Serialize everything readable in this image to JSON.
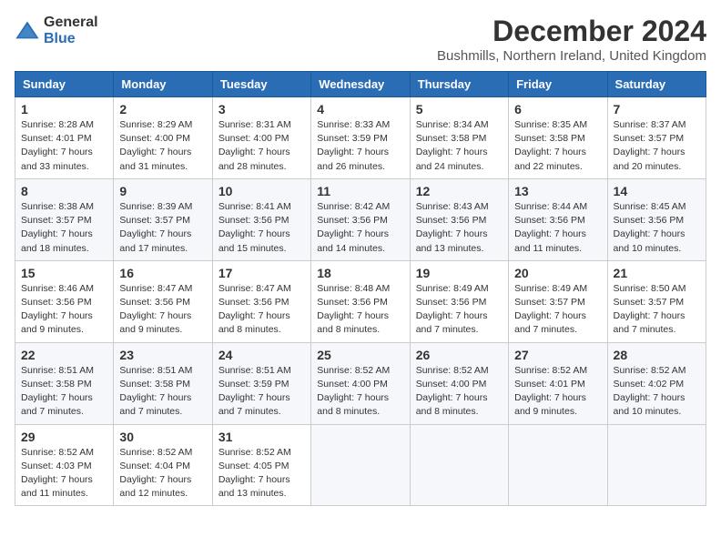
{
  "logo": {
    "general": "General",
    "blue": "Blue"
  },
  "title": "December 2024",
  "location": "Bushmills, Northern Ireland, United Kingdom",
  "days_of_week": [
    "Sunday",
    "Monday",
    "Tuesday",
    "Wednesday",
    "Thursday",
    "Friday",
    "Saturday"
  ],
  "weeks": [
    [
      {
        "day": "1",
        "sunrise": "8:28 AM",
        "sunset": "4:01 PM",
        "daylight": "7 hours and 33 minutes."
      },
      {
        "day": "2",
        "sunrise": "8:29 AM",
        "sunset": "4:00 PM",
        "daylight": "7 hours and 31 minutes."
      },
      {
        "day": "3",
        "sunrise": "8:31 AM",
        "sunset": "4:00 PM",
        "daylight": "7 hours and 28 minutes."
      },
      {
        "day": "4",
        "sunrise": "8:33 AM",
        "sunset": "3:59 PM",
        "daylight": "7 hours and 26 minutes."
      },
      {
        "day": "5",
        "sunrise": "8:34 AM",
        "sunset": "3:58 PM",
        "daylight": "7 hours and 24 minutes."
      },
      {
        "day": "6",
        "sunrise": "8:35 AM",
        "sunset": "3:58 PM",
        "daylight": "7 hours and 22 minutes."
      },
      {
        "day": "7",
        "sunrise": "8:37 AM",
        "sunset": "3:57 PM",
        "daylight": "7 hours and 20 minutes."
      }
    ],
    [
      {
        "day": "8",
        "sunrise": "8:38 AM",
        "sunset": "3:57 PM",
        "daylight": "7 hours and 18 minutes."
      },
      {
        "day": "9",
        "sunrise": "8:39 AM",
        "sunset": "3:57 PM",
        "daylight": "7 hours and 17 minutes."
      },
      {
        "day": "10",
        "sunrise": "8:41 AM",
        "sunset": "3:56 PM",
        "daylight": "7 hours and 15 minutes."
      },
      {
        "day": "11",
        "sunrise": "8:42 AM",
        "sunset": "3:56 PM",
        "daylight": "7 hours and 14 minutes."
      },
      {
        "day": "12",
        "sunrise": "8:43 AM",
        "sunset": "3:56 PM",
        "daylight": "7 hours and 13 minutes."
      },
      {
        "day": "13",
        "sunrise": "8:44 AM",
        "sunset": "3:56 PM",
        "daylight": "7 hours and 11 minutes."
      },
      {
        "day": "14",
        "sunrise": "8:45 AM",
        "sunset": "3:56 PM",
        "daylight": "7 hours and 10 minutes."
      }
    ],
    [
      {
        "day": "15",
        "sunrise": "8:46 AM",
        "sunset": "3:56 PM",
        "daylight": "7 hours and 9 minutes."
      },
      {
        "day": "16",
        "sunrise": "8:47 AM",
        "sunset": "3:56 PM",
        "daylight": "7 hours and 9 minutes."
      },
      {
        "day": "17",
        "sunrise": "8:47 AM",
        "sunset": "3:56 PM",
        "daylight": "7 hours and 8 minutes."
      },
      {
        "day": "18",
        "sunrise": "8:48 AM",
        "sunset": "3:56 PM",
        "daylight": "7 hours and 8 minutes."
      },
      {
        "day": "19",
        "sunrise": "8:49 AM",
        "sunset": "3:56 PM",
        "daylight": "7 hours and 7 minutes."
      },
      {
        "day": "20",
        "sunrise": "8:49 AM",
        "sunset": "3:57 PM",
        "daylight": "7 hours and 7 minutes."
      },
      {
        "day": "21",
        "sunrise": "8:50 AM",
        "sunset": "3:57 PM",
        "daylight": "7 hours and 7 minutes."
      }
    ],
    [
      {
        "day": "22",
        "sunrise": "8:51 AM",
        "sunset": "3:58 PM",
        "daylight": "7 hours and 7 minutes."
      },
      {
        "day": "23",
        "sunrise": "8:51 AM",
        "sunset": "3:58 PM",
        "daylight": "7 hours and 7 minutes."
      },
      {
        "day": "24",
        "sunrise": "8:51 AM",
        "sunset": "3:59 PM",
        "daylight": "7 hours and 7 minutes."
      },
      {
        "day": "25",
        "sunrise": "8:52 AM",
        "sunset": "4:00 PM",
        "daylight": "7 hours and 8 minutes."
      },
      {
        "day": "26",
        "sunrise": "8:52 AM",
        "sunset": "4:00 PM",
        "daylight": "7 hours and 8 minutes."
      },
      {
        "day": "27",
        "sunrise": "8:52 AM",
        "sunset": "4:01 PM",
        "daylight": "7 hours and 9 minutes."
      },
      {
        "day": "28",
        "sunrise": "8:52 AM",
        "sunset": "4:02 PM",
        "daylight": "7 hours and 10 minutes."
      }
    ],
    [
      {
        "day": "29",
        "sunrise": "8:52 AM",
        "sunset": "4:03 PM",
        "daylight": "7 hours and 11 minutes."
      },
      {
        "day": "30",
        "sunrise": "8:52 AM",
        "sunset": "4:04 PM",
        "daylight": "7 hours and 12 minutes."
      },
      {
        "day": "31",
        "sunrise": "8:52 AM",
        "sunset": "4:05 PM",
        "daylight": "7 hours and 13 minutes."
      },
      null,
      null,
      null,
      null
    ]
  ],
  "labels": {
    "sunrise": "Sunrise:",
    "sunset": "Sunset:",
    "daylight": "Daylight:"
  }
}
